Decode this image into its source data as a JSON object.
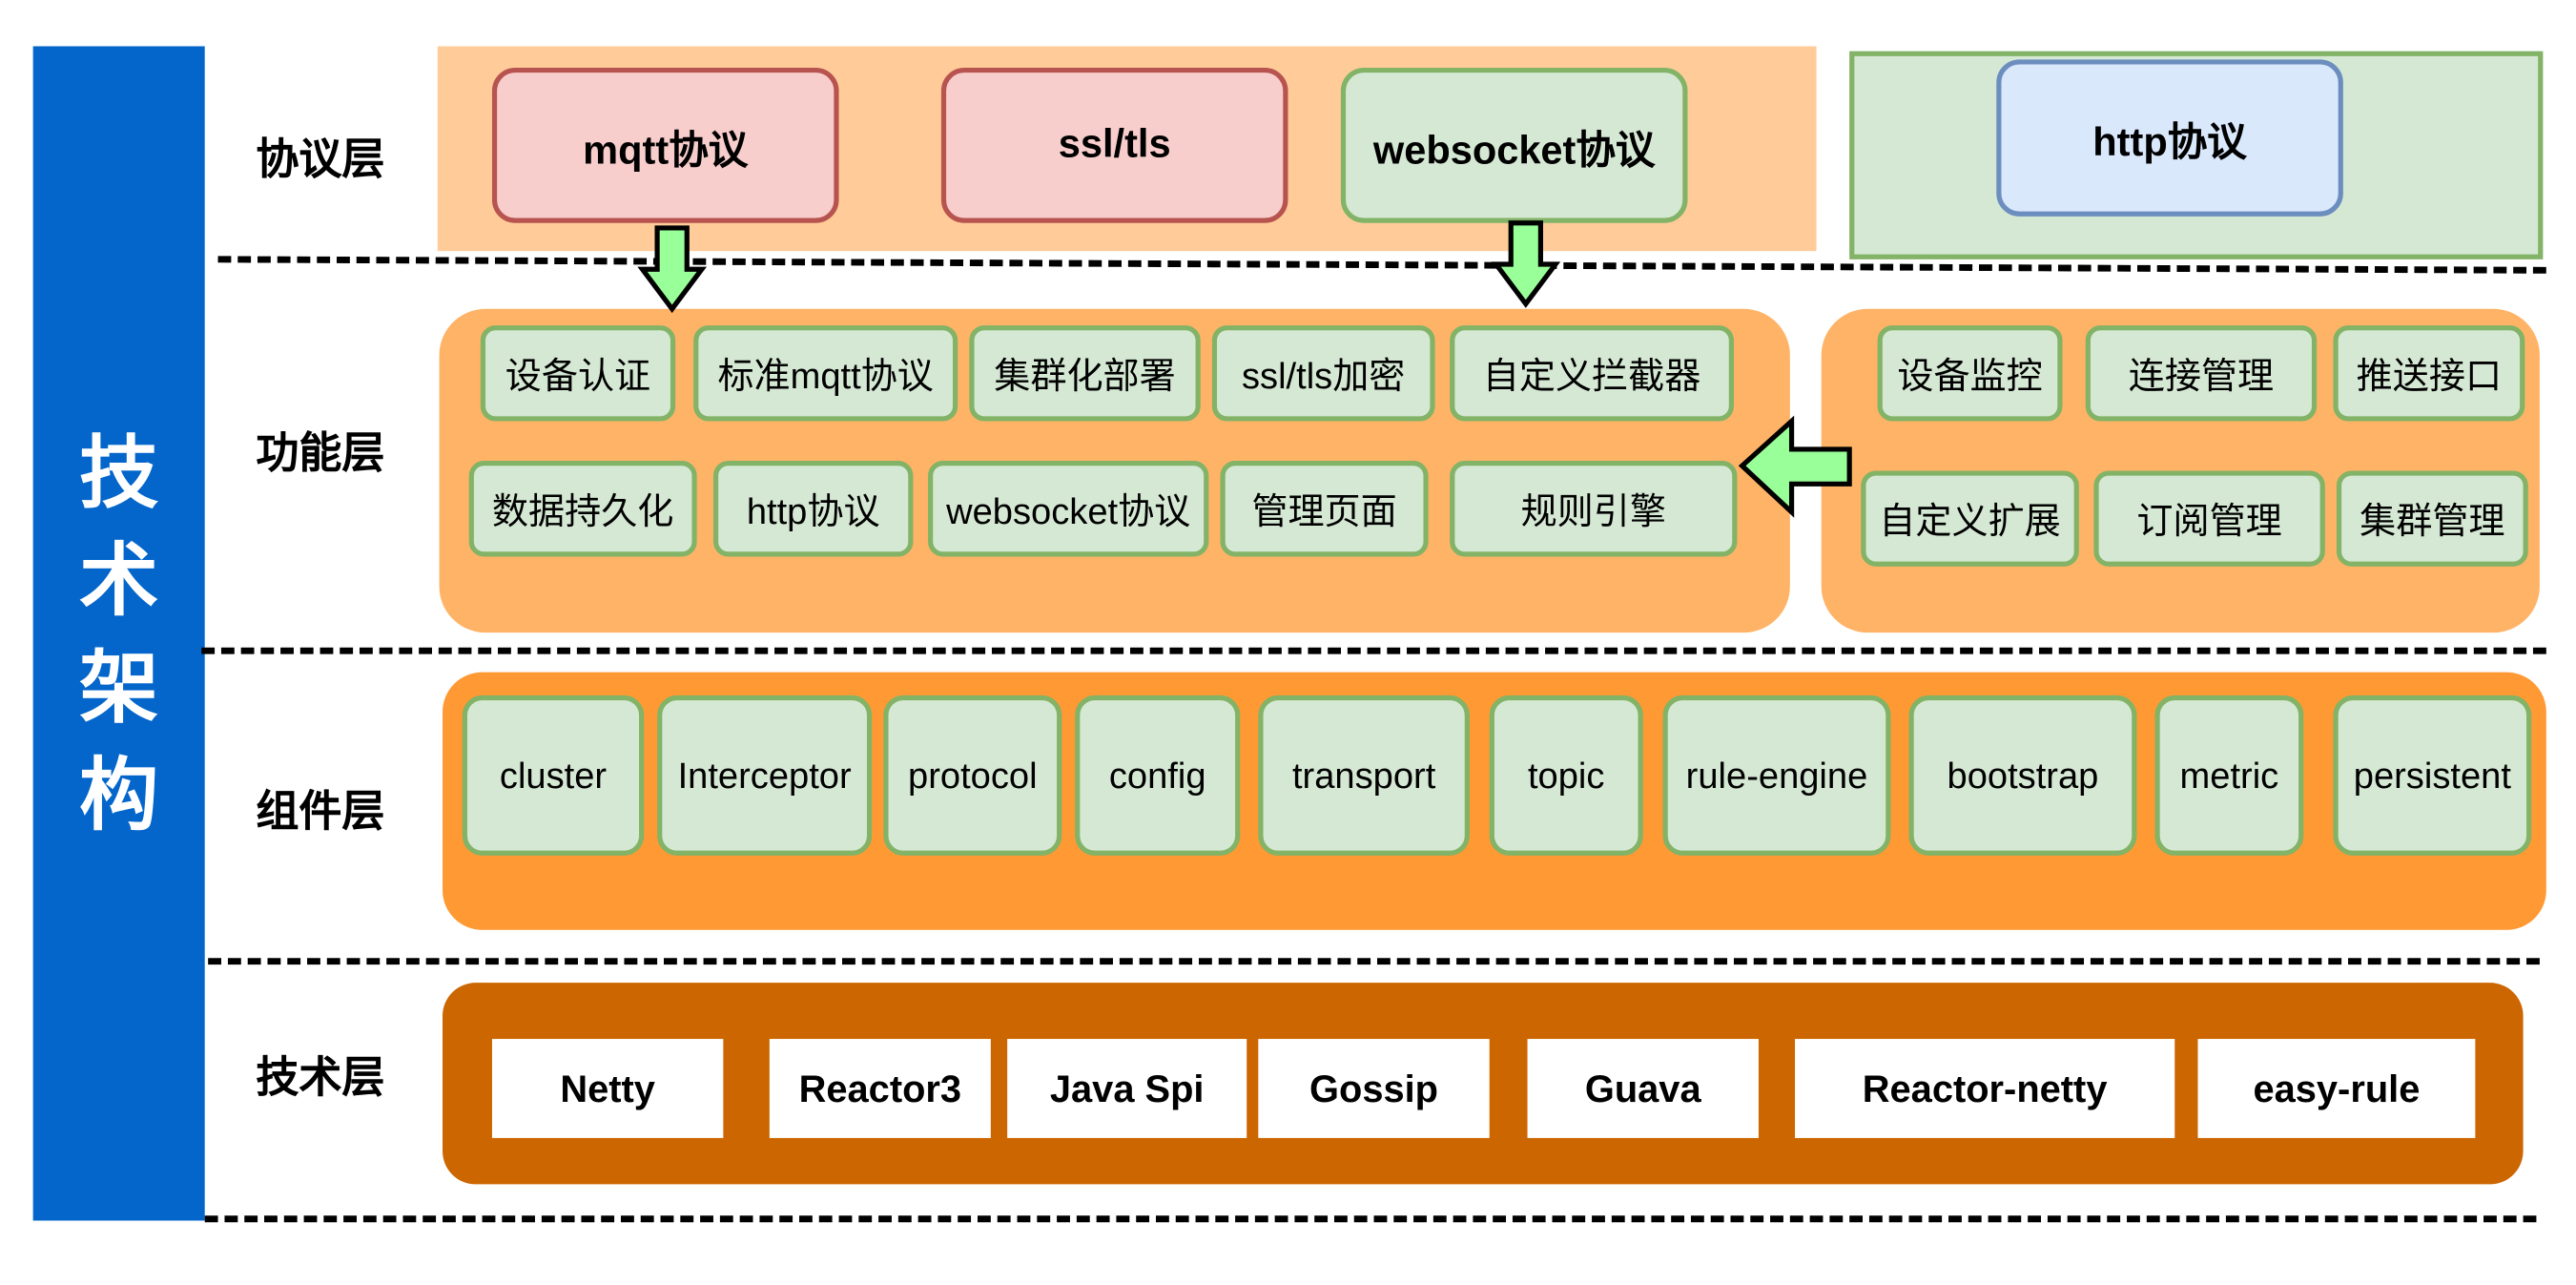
{
  "title": "技术架构",
  "title_chars": [
    "技",
    "术",
    "架",
    "构"
  ],
  "colors": {
    "side_bar": "#0466cb",
    "protocol_panel": "#ffcc99",
    "function_panel": "#ffb366",
    "component_panel": "#ff9933",
    "tech_panel": "#cc6600",
    "green_box_fill": "#d5e8d4",
    "green_box_border": "#82b366",
    "red_box_fill": "#f8cecc",
    "red_box_border": "#b85450",
    "blue_box_fill": "#dae8fc",
    "blue_box_border": "#6c8ebf",
    "arrow_fill": "#99ff99"
  },
  "layers": {
    "protocol": {
      "label": "协议层",
      "items": [
        {
          "label": "mqtt协议",
          "style": "red"
        },
        {
          "label": "ssl/tls",
          "style": "red"
        },
        {
          "label": "websocket协议",
          "style": "green"
        },
        {
          "label": "http协议",
          "style": "blue"
        }
      ]
    },
    "function": {
      "label": "功能层",
      "left_panel": {
        "row1": [
          "设备认证",
          "标准mqtt协议",
          "集群化部署",
          "ssl/tls加密",
          "自定义拦截器"
        ],
        "row2": [
          "数据持久化",
          "http协议",
          "websocket协议",
          "管理页面",
          "规则引擎"
        ]
      },
      "right_panel": {
        "row1": [
          "设备监控",
          "连接管理",
          "推送接口"
        ],
        "row2": [
          "自定义扩展",
          "订阅管理",
          "集群管理"
        ]
      }
    },
    "component": {
      "label": "组件层",
      "items": [
        "cluster",
        "Interceptor",
        "protocol",
        "config",
        "transport",
        "topic",
        "rule-engine",
        "bootstrap",
        "metric",
        "persistent"
      ]
    },
    "tech": {
      "label": "技术层",
      "items": [
        "Netty",
        "Reactor3",
        "Java Spi",
        "Gossip",
        "Guava",
        "Reactor-netty",
        "easy-rule"
      ]
    }
  },
  "arrows": [
    {
      "name": "mqtt-to-function",
      "direction": "down"
    },
    {
      "name": "websocket-to-function",
      "direction": "down"
    },
    {
      "name": "right-panel-to-left-panel",
      "direction": "left"
    }
  ]
}
